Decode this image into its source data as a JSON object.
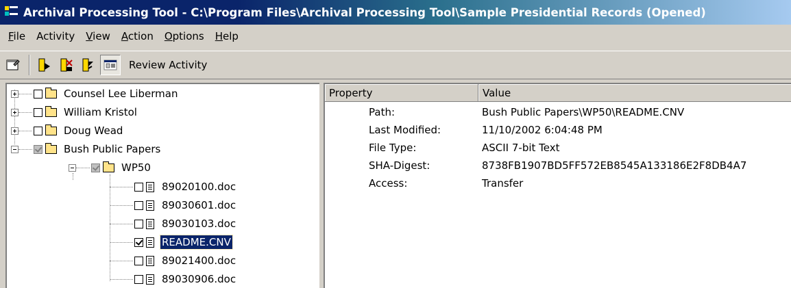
{
  "window": {
    "title": "Archival Processing Tool - C:\\Program Files\\Archival Processing Tool\\Sample Presidential Records (Opened)"
  },
  "menu": {
    "items": [
      {
        "label": "File",
        "accel": "F",
        "rest": "ile"
      },
      {
        "label": "Activity",
        "accel": "",
        "rest": "Activity"
      },
      {
        "label": "View",
        "accel": "V",
        "rest": "iew"
      },
      {
        "label": "Action",
        "accel": "A",
        "rest": "ction"
      },
      {
        "label": "Options",
        "accel": "O",
        "rest": "ptions"
      },
      {
        "label": "Help",
        "accel": "H",
        "rest": "elp"
      }
    ]
  },
  "toolbar": {
    "activity_label": "Review Activity",
    "buttons": [
      "properties-icon",
      "ingest-icon",
      "split-icon",
      "review-icon",
      "activity-view-icon"
    ]
  },
  "tree": {
    "items": [
      {
        "label": "Counsel Lee Liberman",
        "type": "folder",
        "expander": "plus",
        "state": "unchecked"
      },
      {
        "label": "William Kristol",
        "type": "folder",
        "expander": "plus",
        "state": "unchecked"
      },
      {
        "label": "Doug Wead",
        "type": "folder",
        "expander": "plus",
        "state": "unchecked"
      },
      {
        "label": "Bush Public Papers",
        "type": "folder",
        "expander": "minus",
        "state": "partial"
      },
      {
        "label": "WP50",
        "type": "folder",
        "expander": "minus",
        "state": "partial"
      },
      {
        "label": "89020100.doc",
        "type": "file",
        "state": "unchecked"
      },
      {
        "label": "89030601.doc",
        "type": "file",
        "state": "unchecked"
      },
      {
        "label": "89030103.doc",
        "type": "file",
        "state": "unchecked"
      },
      {
        "label": "README.CNV",
        "type": "file",
        "state": "checked",
        "selected": true
      },
      {
        "label": "89021400.doc",
        "type": "file",
        "state": "unchecked"
      },
      {
        "label": "89030906.doc",
        "type": "file",
        "state": "unchecked"
      }
    ]
  },
  "properties": {
    "headers": {
      "property": "Property",
      "value": "Value"
    },
    "rows": [
      {
        "name": "Path:",
        "value": "Bush Public Papers\\WP50\\README.CNV"
      },
      {
        "name": "Last Modified:",
        "value": "11/10/2002 6:04:48 PM"
      },
      {
        "name": "File Type:",
        "value": "ASCII 7-bit Text"
      },
      {
        "name": "SHA-Digest:",
        "value": "8738FB1907BD5FF572EB8545A133186E2F8DB4A7"
      },
      {
        "name": "Access:",
        "value": "Transfer"
      }
    ]
  },
  "colors": {
    "title_active": "#0a246a",
    "selection": "#0a246a",
    "face": "#d4d0c8"
  }
}
